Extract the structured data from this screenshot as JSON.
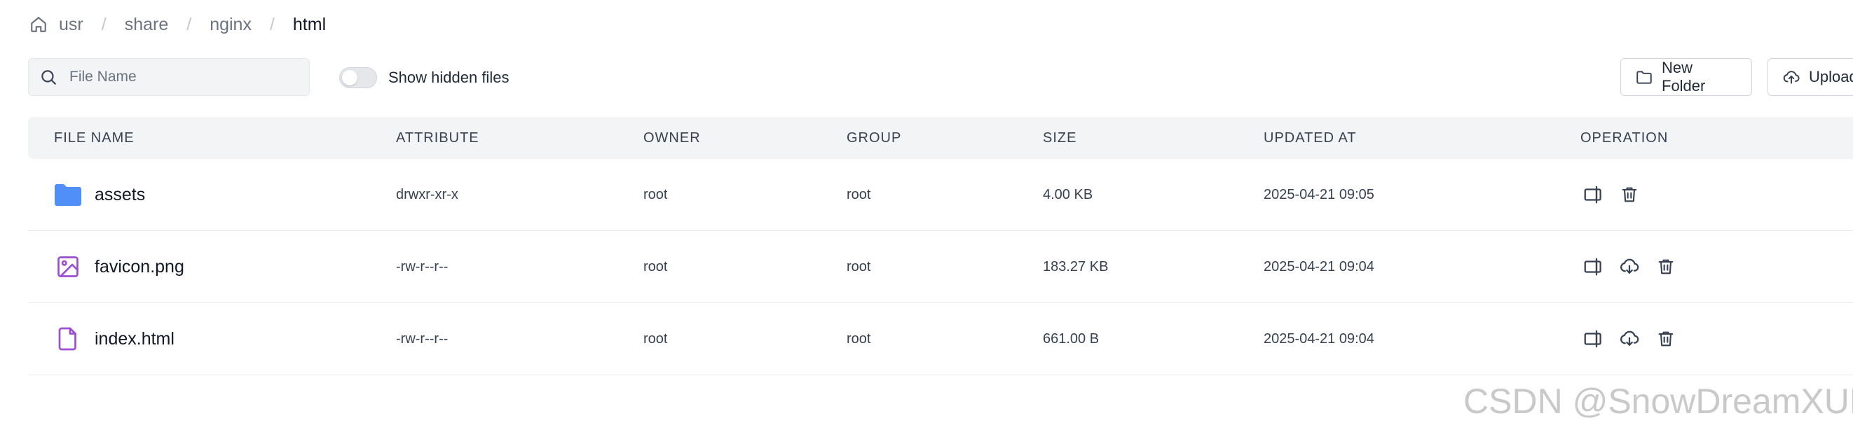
{
  "breadcrumb": {
    "home_icon": "home-icon",
    "items": [
      "usr",
      "share",
      "nginx",
      "html"
    ],
    "separator": "/"
  },
  "toolbar": {
    "search_placeholder": "File Name",
    "search_value": "",
    "show_hidden_label": "Show hidden files",
    "show_hidden_on": false,
    "new_folder_label": "New Folder",
    "upload_label": "Upload"
  },
  "table": {
    "headers": [
      "FILE NAME",
      "ATTRIBUTE",
      "OWNER",
      "GROUP",
      "SIZE",
      "UPDATED AT",
      "OPERATION"
    ],
    "rows": [
      {
        "name": "assets",
        "icon": "folder-icon",
        "attribute": "drwxr-xr-x",
        "owner": "root",
        "group": "root",
        "size": "4.00 KB",
        "updated_at": "2025-04-21 09:05",
        "operations": [
          "rename-icon",
          "delete-icon"
        ]
      },
      {
        "name": "favicon.png",
        "icon": "image-file-icon",
        "attribute": "-rw-r--r--",
        "owner": "root",
        "group": "root",
        "size": "183.27 KB",
        "updated_at": "2025-04-21 09:04",
        "operations": [
          "rename-icon",
          "download-icon",
          "delete-icon"
        ]
      },
      {
        "name": "index.html",
        "icon": "document-file-icon",
        "attribute": "-rw-r--r--",
        "owner": "root",
        "group": "root",
        "size": "661.00 B",
        "updated_at": "2025-04-21 09:04",
        "operations": [
          "rename-icon",
          "download-icon",
          "delete-icon"
        ]
      }
    ]
  },
  "watermark": "CSDN @SnowDreamXUE",
  "colors": {
    "folder": "#4f8ff7",
    "file_icon": "#9b4fd1",
    "header_bg": "#f3f4f6",
    "border": "#e5e7eb",
    "muted_text": "#6b7280"
  }
}
